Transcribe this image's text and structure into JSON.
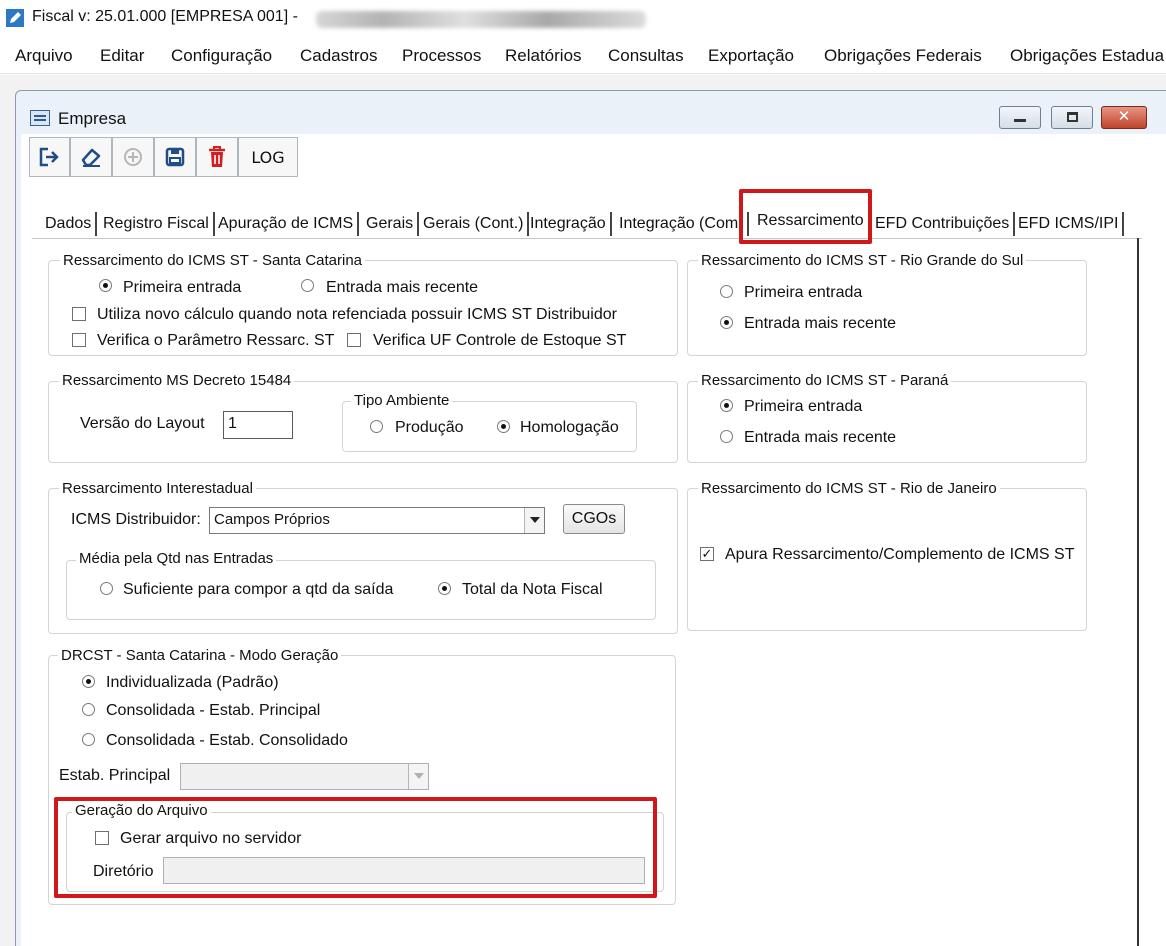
{
  "window": {
    "app_title": "Fiscal  v: 25.01.000  [EMPRESA 001] - ",
    "child_title": "Empresa"
  },
  "menu": [
    "Arquivo",
    "Editar",
    "Configuração",
    "Cadastros",
    "Processos",
    "Relatórios",
    "Consultas",
    "Exportação",
    "Obrigações Federais",
    "Obrigações Estadua"
  ],
  "toolbar": {
    "exit_icon": "exit-icon",
    "clear_icon": "eraser-icon",
    "add_icon": "add-icon",
    "save_icon": "save-icon",
    "delete_icon": "trash-icon",
    "log_label": "LOG"
  },
  "tabs": [
    "Dados",
    "Registro Fiscal",
    "Apuração de ICMS",
    "Gerais",
    "Gerais (Cont.)",
    "Integração",
    "Integração (Com.",
    "Ressarcimento",
    "EFD Contribuições",
    "EFD ICMS/IPI"
  ],
  "active_tab": "Ressarcimento",
  "sc": {
    "legend": "Ressarcimento do ICMS ST - Santa Catarina",
    "opt_primeira": "Primeira entrada",
    "opt_recente": "Entrada mais recente",
    "selected": "Primeira entrada",
    "chk_novo_calculo": "Utiliza novo cálculo quando nota refenciada possuir ICMS ST Distribuidor",
    "chk_novo_calculo_checked": false,
    "chk_parametro": "Verifica o Parâmetro Ressarc. ST",
    "chk_parametro_checked": false,
    "chk_uf": "Verifica UF Controle de Estoque ST",
    "chk_uf_checked": false
  },
  "rs": {
    "legend": "Ressarcimento do ICMS ST - Rio Grande do Sul",
    "opt_primeira": "Primeira entrada",
    "opt_recente": "Entrada mais recente",
    "selected": "Entrada mais recente"
  },
  "ms": {
    "legend": "Ressarcimento MS Decreto 15484",
    "versao_label": "Versão do Layout",
    "versao_value": "1",
    "ambiente_legend": "Tipo Ambiente",
    "opt_producao": "Produção",
    "opt_homologacao": "Homologação",
    "selected": "Homologação"
  },
  "pr": {
    "legend": "Ressarcimento do ICMS ST - Paraná",
    "opt_primeira": "Primeira entrada",
    "opt_recente": "Entrada mais recente",
    "selected": "Primeira entrada"
  },
  "inter": {
    "legend": "Ressarcimento Interestadual",
    "distribuidor_label": "ICMS Distribuidor:",
    "distribuidor_value": "Campos Próprios",
    "cgos_button": "CGOs",
    "media_legend": "Média pela Qtd nas Entradas",
    "opt_suficiente": "Suficiente para compor a qtd da saída",
    "opt_total": "Total da Nota Fiscal",
    "selected": "Total da Nota Fiscal"
  },
  "rj": {
    "legend": "Ressarcimento do ICMS ST - Rio de Janeiro",
    "chk_apura": "Apura Ressarcimento/Complemento de ICMS ST",
    "chk_apura_checked": true
  },
  "drcst": {
    "legend": "DRCST - Santa Catarina - Modo Geração",
    "opt_individualizada": "Individualizada (Padrão)",
    "opt_principal": "Consolidada - Estab. Principal",
    "opt_consolidado": "Consolidada - Estab. Consolidado",
    "selected": "Individualizada (Padrão)",
    "estab_label": "Estab. Principal",
    "estab_value": ""
  },
  "geracao": {
    "legend": "Geração do Arquivo",
    "chk_servidor": "Gerar arquivo no servidor",
    "chk_servidor_checked": false,
    "diretorio_label": "Diretório",
    "diretorio_value": ""
  },
  "colors": {
    "highlight": "#d0181b",
    "window_bg": "#eaf1f8",
    "close_button": "#c0432b"
  }
}
